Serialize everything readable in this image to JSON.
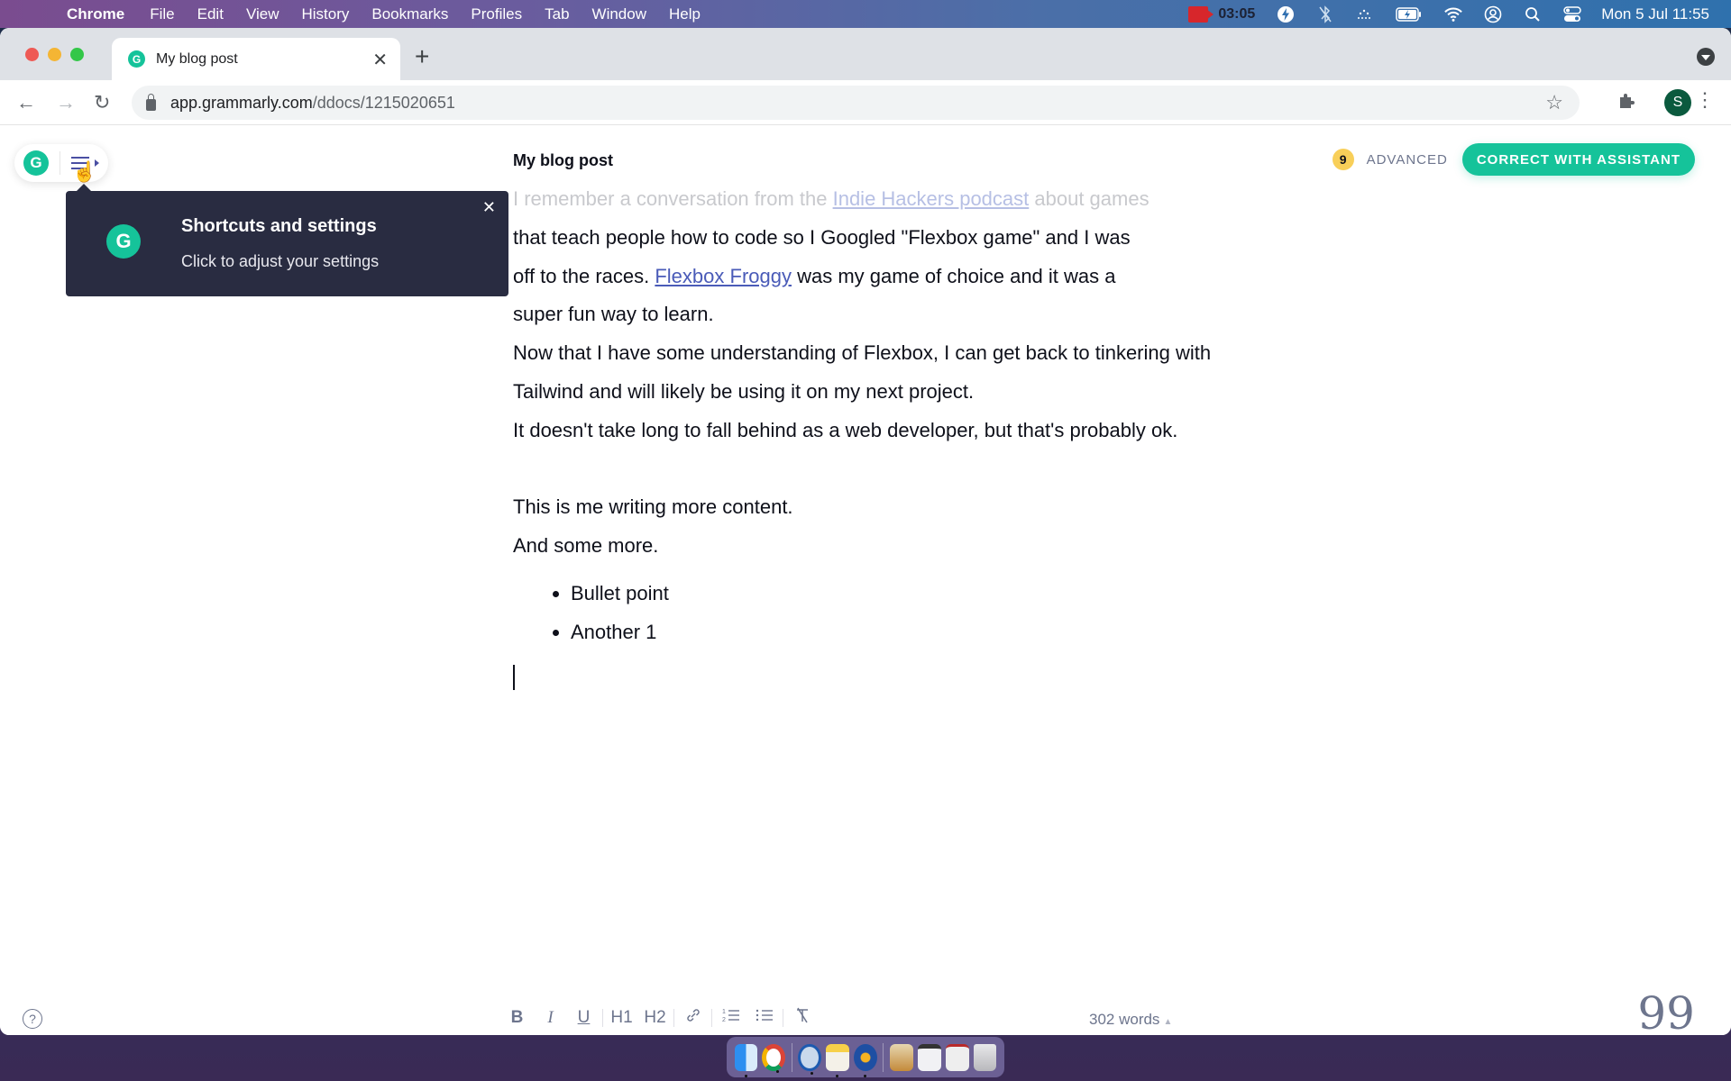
{
  "menubar": {
    "app_name": "Chrome",
    "items": [
      "File",
      "Edit",
      "View",
      "History",
      "Bookmarks",
      "Profiles",
      "Tab",
      "Window",
      "Help"
    ],
    "status": {
      "recording_time": "03:05",
      "icons": [
        "screen-recorder-icon",
        "lightning-app-icon",
        "bluetooth-off-icon",
        "dots-icon",
        "battery-charging-icon",
        "wifi-icon",
        "user-icon",
        "spotlight-search-icon",
        "control-center-icon"
      ],
      "datetime": "Mon 5 Jul  11:55"
    }
  },
  "browser": {
    "tab": {
      "title": "My blog post",
      "favicon": "G"
    },
    "url": {
      "host": "app.grammarly.com",
      "path": "/ddocs/1215020651"
    },
    "profile_initial": "S"
  },
  "grammarly": {
    "logo_letter": "G",
    "tooltip": {
      "title": "Shortcuts and settings",
      "body": "Click to adjust your settings"
    },
    "doc_title": "My blog post",
    "score": "9",
    "goal_label": "ADVANCED",
    "assistant_button": "CORRECT WITH ASSISTANT",
    "content": {
      "faded_line": {
        "before": "I remember a conversation from the ",
        "link": "Indie Hackers podcast",
        "after": " about games"
      },
      "p1_line2": "that teach people how to code so I Googled \"Flexbox game\" and I was",
      "p1_line3": {
        "before": "off to the races. ",
        "link": "Flexbox Froggy",
        "after": " was my game of choice and it was a"
      },
      "p1_line4": "super fun way to learn.",
      "p2": "Now that I have some understanding of Flexbox, I can get back to tinkering with Tailwind and will likely be using it on my next project.",
      "p3": "It doesn't take long to fall behind as a web developer, but that's probably ok.",
      "p4": "This is me writing more content.",
      "p5": "And some more.",
      "bullets": [
        "Bullet point",
        "Another 1"
      ]
    },
    "format_toolbar": {
      "bold": "B",
      "italic": "I",
      "underline": "U",
      "h1": "H1",
      "h2": "H2",
      "link": "🔗",
      "ordered_list": "1≡",
      "bullet_list": "⁝≡",
      "clear_format": "T̸"
    },
    "word_count": "302 words",
    "help": "?",
    "quote": "99"
  },
  "dock": {
    "apps": [
      "Finder",
      "Chrome",
      "1Password",
      "Notes",
      "Reeder",
      "Archive Utility",
      "Chrome window",
      "Window preview",
      "Trash"
    ]
  }
}
